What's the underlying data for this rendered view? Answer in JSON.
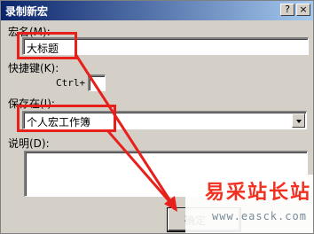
{
  "window": {
    "title": "录制新宏",
    "help_button": "?",
    "close_button": "×"
  },
  "macro_name": {
    "label": "宏名(M):",
    "value": "大标题"
  },
  "shortcut": {
    "label": "快捷键(K):",
    "prefix": "Ctrl+",
    "value": ""
  },
  "store_in": {
    "label": "保存在(I):",
    "selected": "个人宏工作簿"
  },
  "description": {
    "label": "说明(D):",
    "value": ""
  },
  "buttons": {
    "ok_label": "确定"
  },
  "watermark": {
    "text": "易采站长站",
    "url": "www.easck.com"
  },
  "colors": {
    "annotation": "#e8201c",
    "titlebar_start": "#0a246a",
    "titlebar_end": "#a6caf0"
  }
}
